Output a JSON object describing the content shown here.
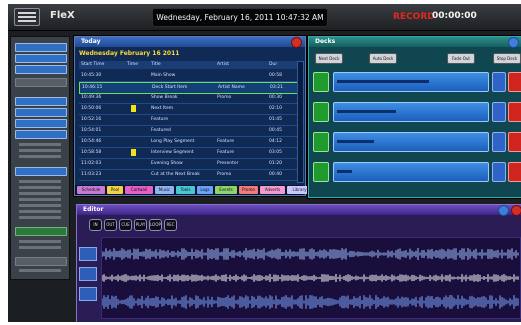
{
  "app": {
    "title": "FleX",
    "datetime": "Wednesday, February 16, 2011 10:47:32 AM",
    "red_indicator": "RECORD",
    "timer": "00:00:00"
  },
  "today_window": {
    "title": "Today",
    "heading": "Wednesday February 16 2011",
    "columns": [
      "Start Time",
      "Time",
      "Title",
      "Artist",
      "Dur"
    ],
    "rows": [
      {
        "time": "10:45:30",
        "title": "Main Show",
        "artist": "",
        "dur": "00:58",
        "selected": false,
        "marker": false
      },
      {
        "time": "10:46:15",
        "title": "Deck Start Item",
        "artist": "Artist Name",
        "dur": "03:21",
        "selected": true,
        "marker": false
      },
      {
        "time": "10:49:36",
        "title": "Show Break",
        "artist": "Promo",
        "dur": "00:30",
        "selected": false,
        "marker": false
      },
      {
        "time": "10:50:06",
        "title": "Next Item",
        "artist": "",
        "dur": "02:10",
        "selected": false,
        "marker": true
      },
      {
        "time": "10:52:16",
        "title": "Feature",
        "artist": "",
        "dur": "01:45",
        "selected": false,
        "marker": false
      },
      {
        "time": "10:54:01",
        "title": "Featured",
        "artist": "",
        "dur": "00:45",
        "selected": false,
        "marker": false
      },
      {
        "time": "10:54:46",
        "title": "Long Play Segment",
        "artist": "Feature",
        "dur": "04:12",
        "selected": false,
        "marker": false
      },
      {
        "time": "10:58:58",
        "title": "Interview Segment",
        "artist": "Feature",
        "dur": "03:05",
        "selected": false,
        "marker": true
      },
      {
        "time": "11:02:03",
        "title": "Evening Show",
        "artist": "Presenter",
        "dur": "01:20",
        "selected": false,
        "marker": false
      },
      {
        "time": "11:03:23",
        "title": "Cut at the Next Break",
        "artist": "Promo",
        "dur": "00:40",
        "selected": false,
        "marker": false
      }
    ],
    "tabs": [
      {
        "label": "Schedule",
        "color": "#c879d6"
      },
      {
        "label": "Pool",
        "color": "#f0d24a"
      },
      {
        "label": "Cartwall",
        "color": "#e65ec8"
      },
      {
        "label": "Music",
        "color": "#8fb4f2"
      },
      {
        "label": "Tools",
        "color": "#47c8d2"
      },
      {
        "label": "Logs",
        "color": "#6aa3ff"
      },
      {
        "label": "Events",
        "color": "#8ed46b"
      },
      {
        "label": "Promo",
        "color": "#f27a7a"
      },
      {
        "label": "Adverts",
        "color": "#f39ad0"
      },
      {
        "label": "Library",
        "color": "#c8c8ff"
      }
    ]
  },
  "decks_window": {
    "title": "Decks",
    "buttons": [
      "Next Deck",
      "Auto Deck",
      "Fade Out",
      "Stop Deck"
    ],
    "decks": [
      {
        "progress": 0.62
      },
      {
        "progress": 0.4
      },
      {
        "progress": 0.25
      },
      {
        "progress": 0.1
      }
    ]
  },
  "editor_window": {
    "title": "Editor",
    "tool_labels": [
      "IN",
      "OUT",
      "CUE",
      "PLAY",
      "LOOP",
      "REC"
    ]
  }
}
